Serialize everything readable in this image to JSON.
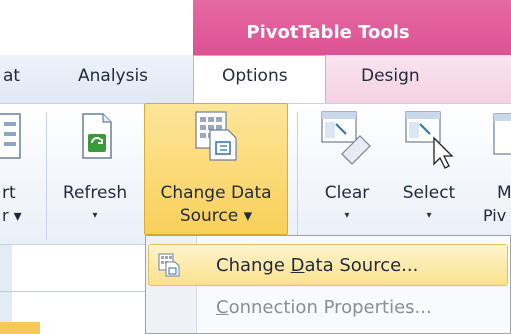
{
  "contextual_group": {
    "title": "PivotTable Tools"
  },
  "tabs": {
    "partial_left": "at",
    "analysis": "Analysis",
    "options": "Options",
    "design": "Design"
  },
  "ribbon": {
    "partial_left_line1": "rt",
    "partial_left_line2": "r ▾",
    "refresh": {
      "label": "Refresh"
    },
    "change_data_source": {
      "line1": "Change Data",
      "line2": "Source ▾"
    },
    "clear": {
      "label": "Clear"
    },
    "select": {
      "label": "Select"
    },
    "partial_right_line1": "M",
    "partial_right_line2": "Piv",
    "dropdown_arrow": "▾"
  },
  "menu": {
    "items": [
      {
        "pre": "Change ",
        "key": "D",
        "post": "ata Source...",
        "enabled": true,
        "highlighted": true
      },
      {
        "pre": "",
        "key": "C",
        "post": "onnection Properties...",
        "enabled": false
      }
    ]
  },
  "colors": {
    "contextual_header": "#e05a99",
    "hover": "#f9cf5a",
    "disabled_text": "#8d8d8d"
  }
}
